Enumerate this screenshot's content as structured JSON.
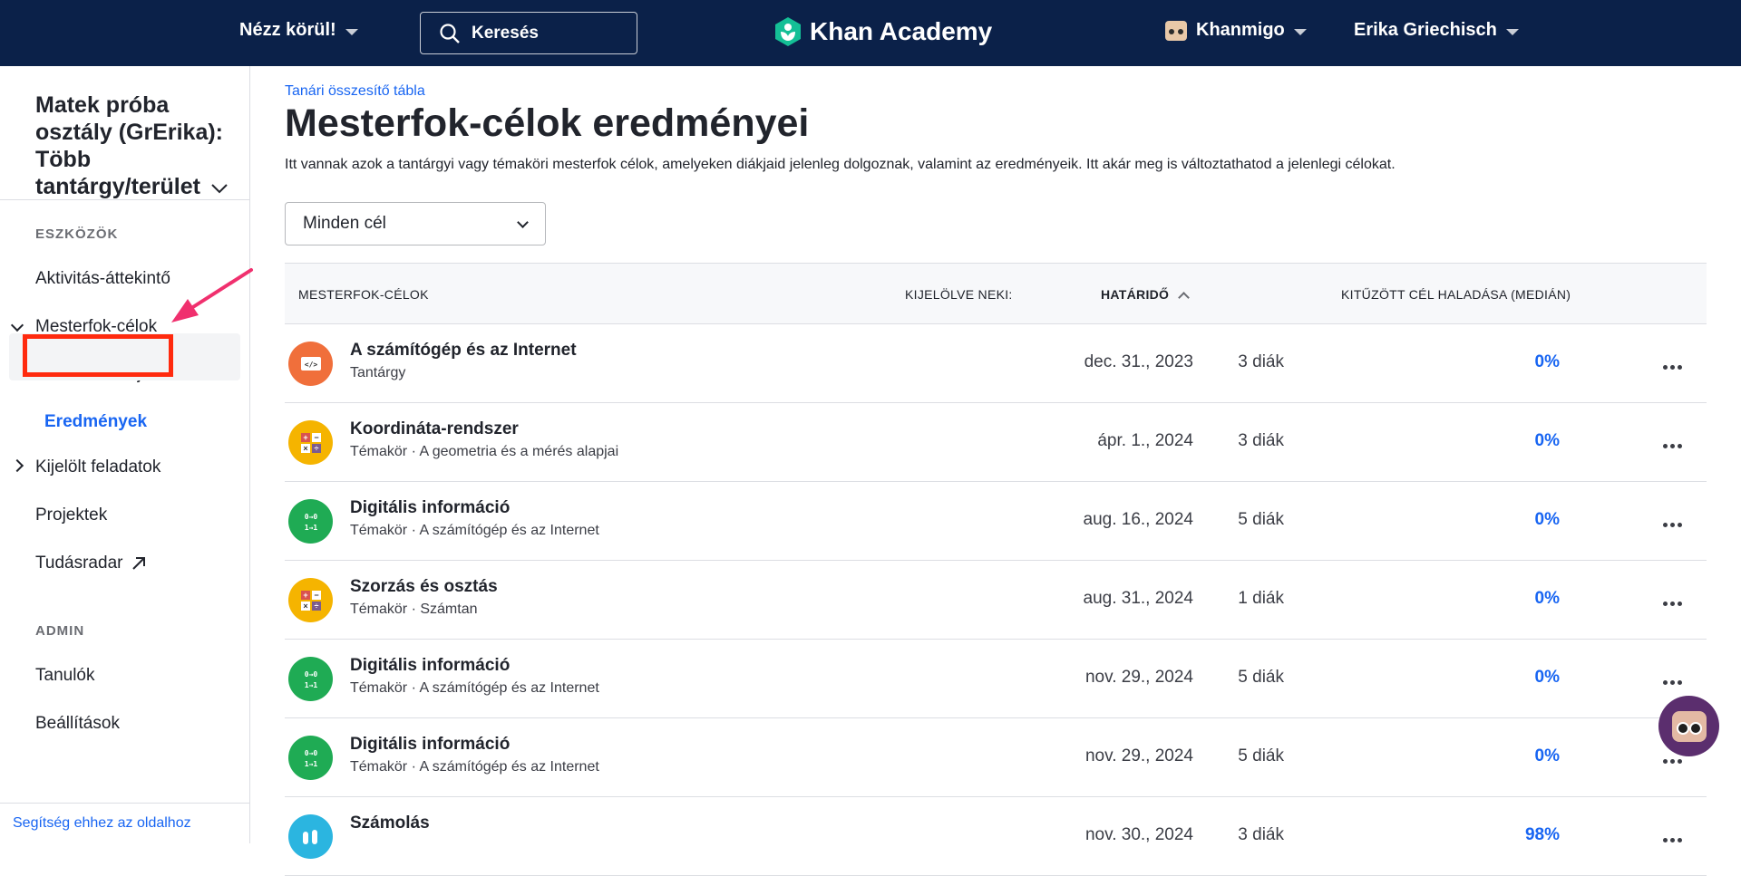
{
  "topbar": {
    "explore_label": "Nézz körül!",
    "search_placeholder": "Keresés",
    "logo_text": "Khan Academy",
    "khanmigo_label": "Khanmigo",
    "user_name": "Erika Griechisch"
  },
  "sidebar": {
    "class_title": "Matek próba osztály (GrErika): Több tantárgy/terület",
    "tools_label": "ESZKÖZÖK",
    "items": [
      {
        "label": "Aktivitás-áttekintő"
      },
      {
        "label": "Mesterfok-célok"
      },
      {
        "label": "Feladatok kijelölése"
      },
      {
        "label": "Eredmények"
      },
      {
        "label": "Kijelölt feladatok"
      },
      {
        "label": "Projektek"
      },
      {
        "label": "Tudásradar"
      }
    ],
    "admin_label": "ADMIN",
    "admin_items": [
      {
        "label": "Tanulók"
      },
      {
        "label": "Beállítások"
      }
    ],
    "help_link": "Segítség ehhez az oldalhoz"
  },
  "main": {
    "breadcrumb": "Tanári összesítő tábla",
    "title": "Mesterfok-célok eredményei",
    "description": "Itt vannak azok a tantárgyi vagy témaköri mesterfok célok, amelyeken diákjaid jelenleg dolgoznak, valamint az eredményeik. Itt akár meg is változtathatod a jelenlegi célokat.",
    "filter_value": "Minden cél",
    "columns": {
      "goals": "MESTERFOK-CÉLOK",
      "assigned": "KIJELÖLVE NEKI:",
      "due": "HATÁRIDŐ",
      "progress": "KITŰZÖTT CÉL HALADÁSA (MEDIÁN)"
    },
    "rows": [
      {
        "name": "A számítógép és az Internet",
        "sub": "Tantárgy",
        "students": "3 diák",
        "due": "dec. 31., 2023",
        "progress": "0%",
        "icon": "computer-icon",
        "icon_color": "#f06f3b"
      },
      {
        "name": "Koordináta-rendszer",
        "sub": "Témakör · A geometria és a mérés alapjai",
        "students": "3 diák",
        "due": "ápr. 1., 2024",
        "progress": "0%",
        "icon": "math-operators-icon",
        "icon_color": "#f5b400"
      },
      {
        "name": "Digitális információ",
        "sub": "Témakör · A számítógép és az Internet",
        "students": "5 diák",
        "due": "aug. 16., 2024",
        "progress": "0%",
        "icon": "binary-icon",
        "icon_color": "#1fab54"
      },
      {
        "name": "Szorzás és osztás",
        "sub": "Témakör · Számtan",
        "students": "1 diák",
        "due": "aug. 31., 2024",
        "progress": "0%",
        "icon": "math-operators-icon",
        "icon_color": "#f5b400"
      },
      {
        "name": "Digitális információ",
        "sub": "Témakör · A számítógép és az Internet",
        "students": "5 diák",
        "due": "nov. 29., 2024",
        "progress": "0%",
        "icon": "binary-icon",
        "icon_color": "#1fab54"
      },
      {
        "name": "Digitális információ",
        "sub": "Témakör · A számítógép és az Internet",
        "students": "5 diák",
        "due": "nov. 29., 2024",
        "progress": "0%",
        "icon": "binary-icon",
        "icon_color": "#1fab54"
      },
      {
        "name": "Számolás",
        "sub": "",
        "students": "3 diák",
        "due": "nov. 30., 2024",
        "progress": "98%",
        "icon": "hands-icon",
        "icon_color": "#2bb5e0"
      }
    ]
  },
  "colors": {
    "topbar": "#0b2149",
    "accent": "#1865f2",
    "highlight_box": "#ff2a0e",
    "annotation_arrow": "#f0306e"
  }
}
